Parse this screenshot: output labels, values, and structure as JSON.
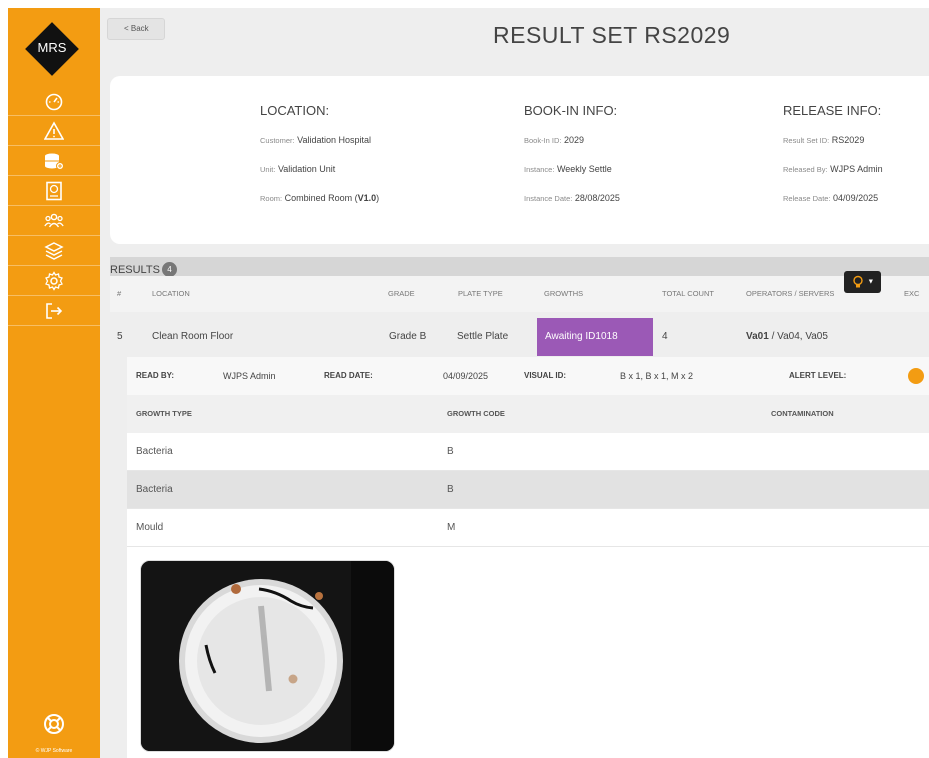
{
  "brand": {
    "logo_text": "MRS",
    "copyright": "© WJP Software"
  },
  "colors": {
    "sidebar": "#f39c12",
    "growths_cell": "#9b59b6",
    "alert": "#f39c12"
  },
  "sidebar": {
    "items": [
      {
        "icon": "speedometer-icon"
      },
      {
        "icon": "warning-icon"
      },
      {
        "icon": "database-add-icon"
      },
      {
        "icon": "passport-icon"
      },
      {
        "icon": "users-icon"
      },
      {
        "icon": "layers-icon"
      },
      {
        "icon": "gear-icon"
      },
      {
        "icon": "logout-icon"
      }
    ],
    "help_icon": "lifebuoy-icon"
  },
  "header": {
    "back_label": "< Back",
    "title": "RESULT SET RS2029"
  },
  "location": {
    "heading": "LOCATION:",
    "customer_label": "Customer:",
    "customer": "Validation Hospital",
    "unit_label": "Unit:",
    "unit": "Validation Unit",
    "room_label": "Room:",
    "room": "Combined Room (",
    "room_version": "V1.0",
    "room_close": ")"
  },
  "bookin": {
    "heading": "BOOK-IN INFO:",
    "id_label": "Book-In ID:",
    "id": "2029",
    "instance_label": "Instance:",
    "instance": "Weekly Settle",
    "date_label": "Instance Date:",
    "date": "28/08/2025"
  },
  "release": {
    "heading": "RELEASE INFO:",
    "set_label": "Result Set ID:",
    "set": "RS2029",
    "by_label": "Released By:",
    "by": "WJPS Admin",
    "date_label": "Release Date:",
    "date": "04/09/2025"
  },
  "results": {
    "label": "RESULTS",
    "count": "4",
    "headers": [
      "#",
      "LOCATION",
      "GRADE",
      "PLATE TYPE",
      "GROWTHS",
      "TOTAL COUNT",
      "OPERATORS / SERVERS",
      "EXC"
    ],
    "row": {
      "num": "5",
      "location": "Clean Room Floor",
      "grade": "Grade B",
      "plate_type": "Settle Plate",
      "growths": "Awaiting ID1018",
      "total_count": "4",
      "operator_main": "Va01",
      "operator_rest": " / Va04, Va05"
    }
  },
  "detail": {
    "read_by_label": "READ BY:",
    "read_by": "WJPS Admin",
    "read_date_label": "READ DATE:",
    "read_date": "04/09/2025",
    "visual_id_label": "VISUAL ID:",
    "visual_id": "B x 1, B x 1, M x 2",
    "alert_label": "ALERT LEVEL:",
    "growth_headers": [
      "GROWTH TYPE",
      "GROWTH CODE",
      "CONTAMINATION"
    ],
    "growths": [
      {
        "type": "Bacteria",
        "code": "B"
      },
      {
        "type": "Bacteria",
        "code": "B"
      },
      {
        "type": "Mould",
        "code": "M"
      }
    ]
  }
}
